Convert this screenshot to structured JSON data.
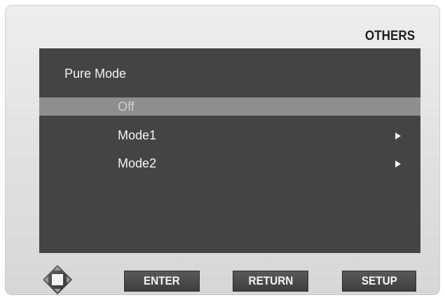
{
  "header": {
    "title": "OTHERS"
  },
  "menu": {
    "heading": "Pure Mode",
    "items": [
      {
        "label": "Off",
        "selected": true,
        "has_submenu": false
      },
      {
        "label": "Mode1",
        "selected": false,
        "has_submenu": true
      },
      {
        "label": "Mode2",
        "selected": false,
        "has_submenu": true
      }
    ]
  },
  "footer": {
    "navigation_icon": "directional-pad-icon",
    "buttons": {
      "enter": "ENTER",
      "return": "RETURN",
      "setup": "SETUP"
    }
  },
  "colors": {
    "panel": "#444444",
    "selected_row": "#8e8e8e",
    "button": "#4a4a4a"
  }
}
